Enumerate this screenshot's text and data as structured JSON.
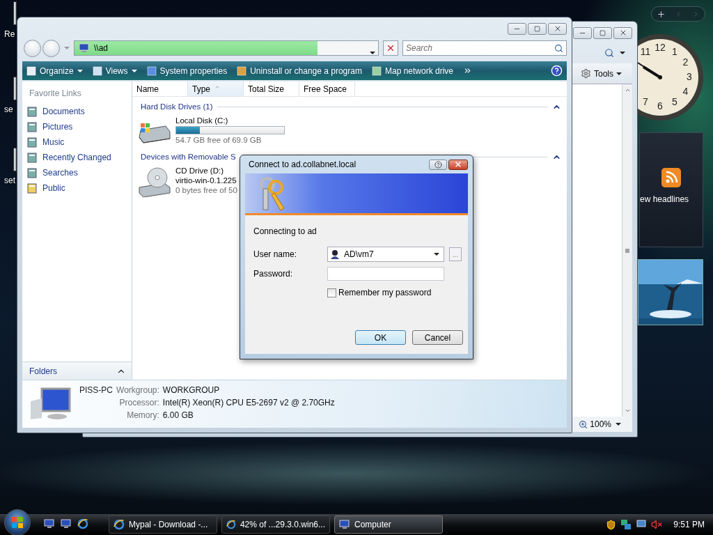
{
  "desktop": {
    "icons": [
      {
        "label": "Re"
      },
      {
        "label": "se"
      },
      {
        "label": "set"
      }
    ]
  },
  "gadgets": {
    "clock": {
      "numerals": [
        "11",
        "12",
        "1",
        "2",
        "3",
        "4",
        "5",
        "6",
        "7"
      ]
    },
    "feed": {
      "label": "ew headlines"
    }
  },
  "background_window": {
    "tools_menu": "Tools",
    "zoom": "100%"
  },
  "explorer": {
    "address": {
      "text": "\\\\ad",
      "level": 0.8
    },
    "search": {
      "placeholder": "Search"
    },
    "toolbar": [
      {
        "label": "Organize",
        "dropdown": true
      },
      {
        "label": "Views",
        "dropdown": true
      },
      {
        "label": "System properties",
        "dropdown": false
      },
      {
        "label": "Uninstall or change a program",
        "dropdown": false
      },
      {
        "label": "Map network drive",
        "dropdown": false
      }
    ],
    "sidebar": {
      "title": "Favorite Links",
      "items": [
        {
          "label": "Documents"
        },
        {
          "label": "Pictures"
        },
        {
          "label": "Music"
        },
        {
          "label": "Recently Changed"
        },
        {
          "label": "Searches"
        },
        {
          "label": "Public"
        }
      ],
      "folders": "Folders"
    },
    "columns": [
      {
        "label": "Name",
        "sorted": false
      },
      {
        "label": "Type",
        "sorted": true
      },
      {
        "label": "Total Size",
        "sorted": false
      },
      {
        "label": "Free Space",
        "sorted": false
      }
    ],
    "groups": [
      {
        "title": "Hard Disk Drives (1)",
        "expanded": true,
        "items": [
          {
            "kind": "disk",
            "name": "Local Disk (C:)",
            "level": 0.22,
            "detail": "54.7 GB free of 69.9 GB"
          }
        ]
      },
      {
        "title": "Devices with Removable S",
        "expanded": true,
        "items": [
          {
            "kind": "cd",
            "name": "CD Drive (D:)",
            "label": "virtio-win-0.1.225",
            "detail": "0 bytes free of 50"
          }
        ]
      }
    ],
    "details": {
      "name": "PISS-PC",
      "fields": [
        {
          "label": "Workgroup:",
          "value": "WORKGROUP"
        },
        {
          "label": "Processor:",
          "value": "Intel(R) Xeon(R) CPU E5-2697 v2 @ 2.70GHz"
        },
        {
          "label": "Memory:",
          "value": "6.00 GB"
        }
      ]
    }
  },
  "dialog": {
    "title": "Connect to ad.collabnet.local",
    "message": "Connecting to ad",
    "username": {
      "label": "User name:",
      "value": "AD\\vm7"
    },
    "browse": "...",
    "password": {
      "label": "Password:"
    },
    "remember": {
      "label": "Remember my password",
      "checked": false
    },
    "buttons": [
      {
        "label": "OK",
        "default": true
      },
      {
        "label": "Cancel",
        "default": false
      }
    ]
  },
  "taskbar": {
    "tasks": [
      {
        "label": "Mypal - Download -...",
        "kind": "browser",
        "selected": false
      },
      {
        "label": "42% of ...29.3.0.win6...",
        "kind": "browser",
        "selected": false
      },
      {
        "label": "Computer",
        "kind": "computer",
        "selected": true
      }
    ],
    "time": "9:51 PM"
  }
}
